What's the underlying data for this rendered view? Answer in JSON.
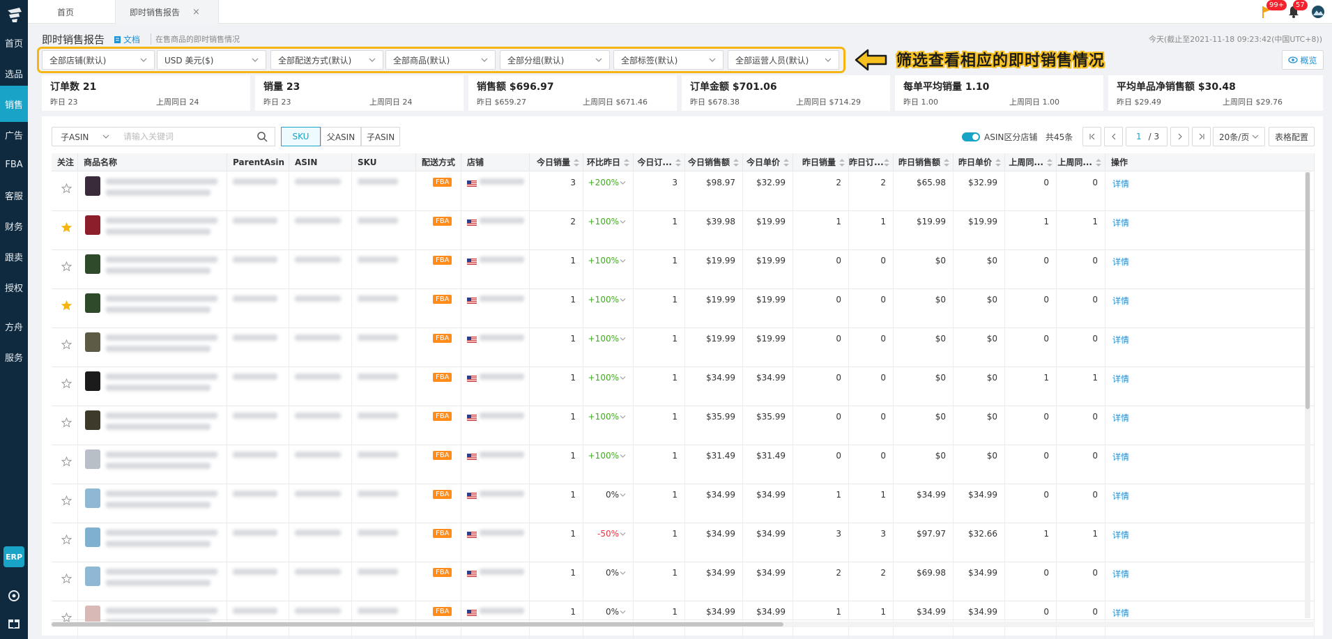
{
  "sidebar": {
    "items": [
      {
        "label": "首页",
        "active": false
      },
      {
        "label": "选品",
        "active": false
      },
      {
        "label": "销售",
        "active": true
      },
      {
        "label": "广告",
        "active": false
      },
      {
        "label": "FBA",
        "active": false
      },
      {
        "label": "客服",
        "active": false
      },
      {
        "label": "财务",
        "active": false
      },
      {
        "label": "跟卖",
        "active": false
      },
      {
        "label": "授权",
        "active": false
      },
      {
        "label": "方舟",
        "active": false
      },
      {
        "label": "服务",
        "active": false
      }
    ],
    "erp_label": "ERP"
  },
  "tabs": [
    {
      "label": "首页"
    },
    {
      "label": "即时销售报告",
      "close": "×"
    }
  ],
  "notifications": {
    "flag_count": "99+",
    "bell_count": "57"
  },
  "header": {
    "title": "即时销售报告",
    "doc_label": "文档",
    "description": "在售商品的即时销售情况",
    "today": "今天(截止至2021-11-18 09:23:42(中国UTC+8))"
  },
  "filters": [
    "全部店铺(默认)",
    "USD  美元($)",
    "全部配送方式(默认)",
    "全部商品(默认)",
    "全部分组(默认)",
    "全部标签(默认)",
    "全部运营人员(默认)"
  ],
  "annotation": "筛选查看相应的即时销售情况",
  "overview_label": "概览",
  "stats": [
    {
      "title": "订单数 21",
      "yesterday": "昨日 23",
      "last_week": "上周同日 24"
    },
    {
      "title": "销量 23",
      "yesterday": "昨日 23",
      "last_week": "上周同日 24"
    },
    {
      "title": "销售额 $696.97",
      "yesterday": "昨日 $659.27",
      "last_week": "上周同日 $671.46"
    },
    {
      "title": "订单金额 $701.06",
      "yesterday": "昨日 $678.38",
      "last_week": "上周同日 $714.29"
    },
    {
      "title": "每单平均销量 1.10",
      "yesterday": "昨日 1.00",
      "last_week": "上周同日 1.00"
    },
    {
      "title": "平均单品净销售额 $30.48",
      "yesterday": "昨日 $29.49",
      "last_week": "上周同日 $29.76"
    }
  ],
  "toolbar": {
    "asin_select": "子ASIN",
    "search_placeholder": "请输入关键词",
    "segments": [
      {
        "label": "SKU",
        "active": true
      },
      {
        "label": "父ASIN",
        "active": false
      },
      {
        "label": "子ASIN",
        "active": false
      }
    ],
    "toggle_label": "ASIN区分店铺",
    "total": "共45条",
    "page": "1",
    "page_total": "/ 3",
    "page_size": "20条/页",
    "table_config": "表格配置"
  },
  "columns": [
    "关注",
    "商品名称",
    "ParentAsin",
    "ASIN",
    "SKU",
    "配送方式",
    "店铺",
    "今日销量",
    "环比昨日",
    "今日订...",
    "今日销售额",
    "今日单价",
    "昨日销量",
    "昨日订...",
    "昨日销售额",
    "昨日单价",
    "上周同...",
    "上周同...",
    "操作"
  ],
  "rows": [
    {
      "starred": false,
      "thumb": "#3a2b3a",
      "ship": "FBA",
      "today_qty": "3",
      "change": "+200%",
      "trend": "up",
      "today_orders": "3",
      "today_sales": "$98.97",
      "today_price": "$32.99",
      "yd_qty": "2",
      "yd_orders": "2",
      "yd_sales": "$65.98",
      "yd_price": "$32.99",
      "lw1": "0",
      "lw2": "0",
      "action": "详情"
    },
    {
      "starred": true,
      "thumb": "#8b1e2a",
      "ship": "FBA",
      "today_qty": "2",
      "change": "+100%",
      "trend": "up",
      "today_orders": "1",
      "today_sales": "$39.98",
      "today_price": "$19.99",
      "yd_qty": "1",
      "yd_orders": "1",
      "yd_sales": "$19.99",
      "yd_price": "$19.99",
      "lw1": "1",
      "lw2": "1",
      "action": "详情"
    },
    {
      "starred": false,
      "thumb": "#2f4a2a",
      "ship": "FBA",
      "today_qty": "1",
      "change": "+100%",
      "trend": "up",
      "today_orders": "1",
      "today_sales": "$19.99",
      "today_price": "$19.99",
      "yd_qty": "0",
      "yd_orders": "0",
      "yd_sales": "$0",
      "yd_price": "$0",
      "lw1": "0",
      "lw2": "0",
      "action": "详情"
    },
    {
      "starred": true,
      "thumb": "#2f4a2a",
      "ship": "FBA",
      "today_qty": "1",
      "change": "+100%",
      "trend": "up",
      "today_orders": "1",
      "today_sales": "$19.99",
      "today_price": "$19.99",
      "yd_qty": "0",
      "yd_orders": "0",
      "yd_sales": "$0",
      "yd_price": "$0",
      "lw1": "0",
      "lw2": "0",
      "action": "详情"
    },
    {
      "starred": false,
      "thumb": "#5d5a46",
      "ship": "FBA",
      "today_qty": "1",
      "change": "+100%",
      "trend": "up",
      "today_orders": "1",
      "today_sales": "$19.99",
      "today_price": "$19.99",
      "yd_qty": "0",
      "yd_orders": "0",
      "yd_sales": "$0",
      "yd_price": "$0",
      "lw1": "0",
      "lw2": "0",
      "action": "详情"
    },
    {
      "starred": false,
      "thumb": "#1b1b1b",
      "ship": "FBA",
      "today_qty": "1",
      "change": "+100%",
      "trend": "up",
      "today_orders": "1",
      "today_sales": "$34.99",
      "today_price": "$34.99",
      "yd_qty": "0",
      "yd_orders": "0",
      "yd_sales": "$0",
      "yd_price": "$0",
      "lw1": "1",
      "lw2": "1",
      "action": "详情"
    },
    {
      "starred": false,
      "thumb": "#3d3a2c",
      "ship": "FBA",
      "today_qty": "1",
      "change": "+100%",
      "trend": "up",
      "today_orders": "1",
      "today_sales": "$35.99",
      "today_price": "$35.99",
      "yd_qty": "0",
      "yd_orders": "0",
      "yd_sales": "$0",
      "yd_price": "$0",
      "lw1": "0",
      "lw2": "0",
      "action": "详情"
    },
    {
      "starred": false,
      "thumb": "#b9bfc6",
      "ship": "FBA",
      "today_qty": "1",
      "change": "+100%",
      "trend": "up",
      "today_orders": "1",
      "today_sales": "$31.49",
      "today_price": "$31.49",
      "yd_qty": "0",
      "yd_orders": "0",
      "yd_sales": "$0",
      "yd_price": "$0",
      "lw1": "0",
      "lw2": "0",
      "action": "详情"
    },
    {
      "starred": false,
      "thumb": "#8fb8d4",
      "ship": "FBA",
      "today_qty": "1",
      "change": "0%",
      "trend": "flat",
      "today_orders": "1",
      "today_sales": "$34.99",
      "today_price": "$34.99",
      "yd_qty": "1",
      "yd_orders": "1",
      "yd_sales": "$34.99",
      "yd_price": "$34.99",
      "lw1": "0",
      "lw2": "0",
      "action": "详情"
    },
    {
      "starred": false,
      "thumb": "#7fb0d0",
      "ship": "FBA",
      "today_qty": "1",
      "change": "-50%",
      "trend": "down",
      "today_orders": "1",
      "today_sales": "$34.99",
      "today_price": "$34.99",
      "yd_qty": "3",
      "yd_orders": "3",
      "yd_sales": "$97.97",
      "yd_price": "$32.66",
      "lw1": "1",
      "lw2": "1",
      "action": "详情"
    },
    {
      "starred": false,
      "thumb": "#8fb8d4",
      "ship": "FBA",
      "today_qty": "1",
      "change": "0%",
      "trend": "flat",
      "today_orders": "1",
      "today_sales": "$34.99",
      "today_price": "$34.99",
      "yd_qty": "2",
      "yd_orders": "2",
      "yd_sales": "$69.98",
      "yd_price": "$34.99",
      "lw1": "0",
      "lw2": "0",
      "action": "详情"
    },
    {
      "starred": false,
      "thumb": "#d9b9b6",
      "ship": "FBA",
      "today_qty": "1",
      "change": "0%",
      "trend": "flat",
      "today_orders": "1",
      "today_sales": "$34.99",
      "today_price": "$34.99",
      "yd_qty": "1",
      "yd_orders": "1",
      "yd_sales": "$34.99",
      "yd_price": "$34.99",
      "lw1": "0",
      "lw2": "0",
      "action": "详情"
    }
  ],
  "colors": {
    "accent": "#19a3c7",
    "sidebar": "#0f2a3e",
    "highlight": "#f6b513",
    "fba": "#ff8c1a",
    "up": "#3fab1d",
    "down": "#e8333d",
    "link": "#1e90d6"
  },
  "icons": {
    "flag": "flag-icon",
    "bell": "bell-icon",
    "star": "star-icon",
    "search": "search-icon",
    "arrow": "arrow-left-icon",
    "eye": "eye-icon"
  }
}
